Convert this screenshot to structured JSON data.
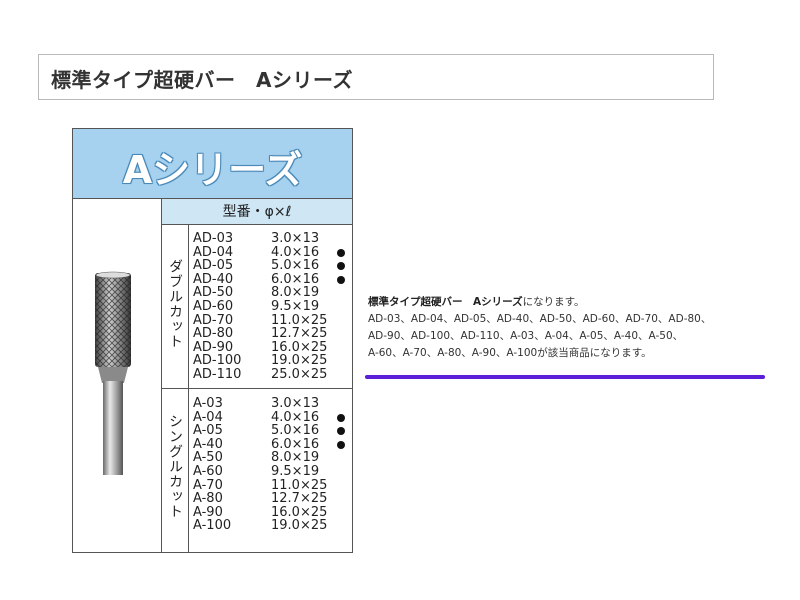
{
  "page": {
    "title": "標準タイプ超硬バー　Aシリーズ"
  },
  "spec_card": {
    "header": "Aシリーズ",
    "subheader": "型番・φ×ℓ",
    "double_cut": {
      "label": "ダブルカット",
      "rows": [
        {
          "code": "AD-03",
          "dim": "3.0×13",
          "dot": false
        },
        {
          "code": "AD-04",
          "dim": "4.0×16",
          "dot": true
        },
        {
          "code": "AD-05",
          "dim": "5.0×16",
          "dot": true
        },
        {
          "code": "AD-40",
          "dim": "6.0×16",
          "dot": true
        },
        {
          "code": "AD-50",
          "dim": "8.0×19",
          "dot": false
        },
        {
          "code": "AD-60",
          "dim": "9.5×19",
          "dot": false
        },
        {
          "code": "AD-70",
          "dim": "11.0×25",
          "dot": false
        },
        {
          "code": "AD-80",
          "dim": "12.7×25",
          "dot": false
        },
        {
          "code": "AD-90",
          "dim": "16.0×25",
          "dot": false
        },
        {
          "code": "AD-100",
          "dim": "19.0×25",
          "dot": false
        },
        {
          "code": "AD-110",
          "dim": "25.0×25",
          "dot": false
        }
      ]
    },
    "single_cut": {
      "label": "シングルカット",
      "rows": [
        {
          "code": "A-03",
          "dim": "3.0×13",
          "dot": false
        },
        {
          "code": "A-04",
          "dim": "4.0×16",
          "dot": true
        },
        {
          "code": "A-05",
          "dim": "5.0×16",
          "dot": true
        },
        {
          "code": "A-40",
          "dim": "6.0×16",
          "dot": true
        },
        {
          "code": "A-50",
          "dim": "8.0×19",
          "dot": false
        },
        {
          "code": "A-60",
          "dim": "9.5×19",
          "dot": false
        },
        {
          "code": "A-70",
          "dim": "11.0×25",
          "dot": false
        },
        {
          "code": "A-80",
          "dim": "12.7×25",
          "dot": false
        },
        {
          "code": "A-90",
          "dim": "16.0×25",
          "dot": false
        },
        {
          "code": "A-100",
          "dim": "19.0×25",
          "dot": false
        }
      ]
    }
  },
  "description": {
    "bold": "標準タイプ超硬バー　Aシリーズ",
    "line1_rest": "になります。",
    "line2": "AD-03、AD-04、AD-05、AD-40、AD-50、AD-60、AD-70、AD-80、",
    "line3": "AD-90、AD-100、AD-110、A-03、A-04、A-05、A-40、A-50、",
    "line4": "A-60、A-70、A-80、A-90、A-100が該当商品になります。"
  },
  "colors": {
    "header_bg": "#a6d2ef",
    "subheader_bg": "#cfe6f5",
    "accent_line": "#5a1fd6"
  }
}
